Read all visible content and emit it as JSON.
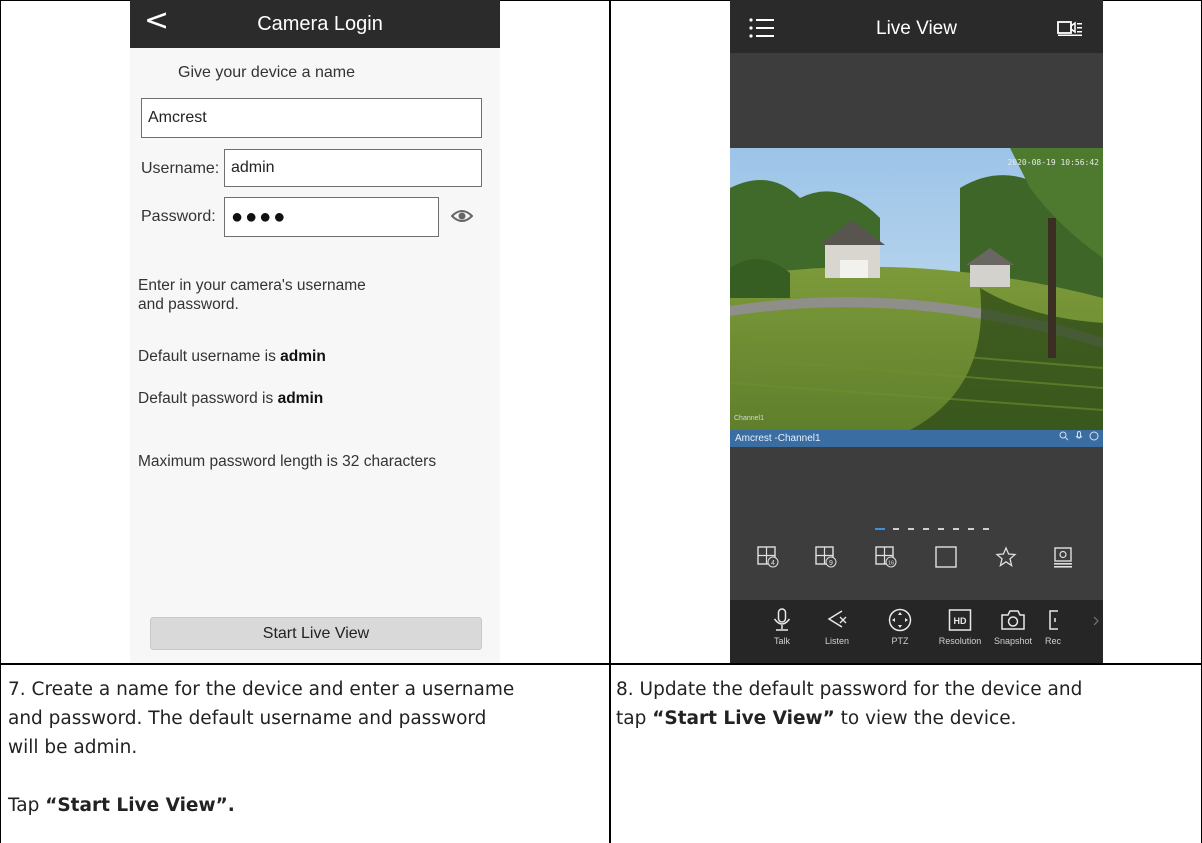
{
  "login": {
    "back_glyph": "<",
    "title": "Camera Login",
    "subtitle": "Give your device a name",
    "device_name_value": "Amcrest",
    "username_label": "Username:",
    "username_value": "admin",
    "password_label": "Password:",
    "password_value": "●●●●",
    "note_line1": "Enter in your camera's username",
    "note_line2": "and password.",
    "default_user_prefix": "Default username is",
    "default_user_value": "admin",
    "default_pass_prefix": "Default password is",
    "default_pass_value": "admin",
    "max_length_note": "Maximum password length is 32 characters",
    "start_button": "Start Live View",
    "icons": [
      "back-icon",
      "eye-icon"
    ]
  },
  "live": {
    "title": "Live View",
    "timestamp": "2020-08-19 10:56:42",
    "channel_overlay": "Channel1",
    "channel_name": "Amcrest -Channel1",
    "pager_total": 8,
    "pager_active": 1,
    "layout_icons": [
      "grid-4-icon",
      "grid-9-icon",
      "grid-16-icon",
      "single-view-icon",
      "favorite-star-icon",
      "device-list-icon"
    ],
    "tools": [
      {
        "label": "Talk",
        "icon": "microphone-icon"
      },
      {
        "label": "Listen",
        "icon": "speaker-mute-icon"
      },
      {
        "label": "PTZ",
        "icon": "ptz-icon"
      },
      {
        "label": "Resolution",
        "icon": "hd-icon"
      },
      {
        "label": "Snapshot",
        "icon": "camera-icon"
      },
      {
        "label": "Rec",
        "icon": "record-icon"
      }
    ],
    "hd_text": "HD"
  },
  "captions": {
    "left_line1": "7. Create a name for the device and enter a username",
    "left_line2": "and password. The default username and password",
    "left_line3": "will be admin.",
    "left_tap_prefix": "Tap ",
    "left_tap_bold": "“Start Live View”.",
    "right_line1": "8. Update the default password for the device and",
    "right_tap_prefix": "tap ",
    "right_tap_bold": "“Start Live View”",
    "right_tap_suffix": " to view the device."
  }
}
